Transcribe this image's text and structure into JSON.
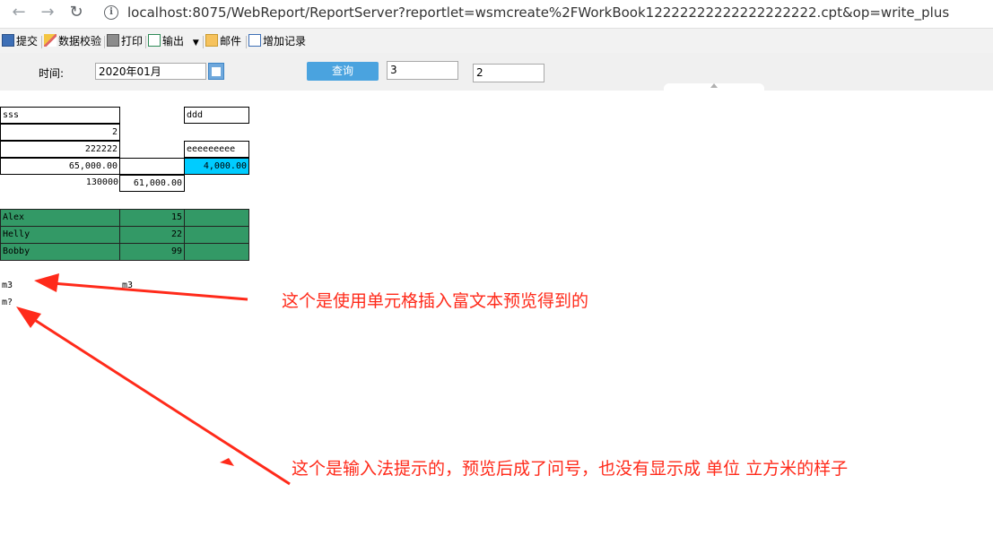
{
  "browser": {
    "url": "localhost:8075/WebReport/ReportServer?reportlet=wsmcreate%2FWorkBook12222222222222222222.cpt&op=write_plus",
    "back_icon": "arrow-left-icon",
    "forward_icon": "arrow-right-icon",
    "reload_icon": "reload-icon",
    "info_icon": "info-icon"
  },
  "toolbar": {
    "submit": "提交",
    "validate": "数据校验",
    "print": "打印",
    "export": "输出",
    "mail": "邮件",
    "add_record": "增加记录"
  },
  "params": {
    "time_label": "时间:",
    "date_value": "2020年01月",
    "query_label": "查询",
    "input1_value": "3",
    "input2_value": "2"
  },
  "report": {
    "sss": "sss",
    "ddd": "ddd",
    "val_2": "2",
    "val_222222": "222222",
    "val_eee": "eeeeeeeee",
    "val_65000": "65,000.00",
    "val_4000": "4,000.00",
    "val_130000": "130000",
    "val_61000": "61,000.00",
    "people": [
      {
        "name": "Alex",
        "value": "15"
      },
      {
        "name": "Helly",
        "value": "22"
      },
      {
        "name": "Bobby",
        "value": "99"
      }
    ],
    "m3_a": "m3",
    "m3_b": "m3",
    "m_q": "m?"
  },
  "annotations": {
    "note1": "这个是使用单元格插入富文本预览得到的",
    "note2": "这个是输入法提示的，预览后成了问号，也没有显示成 单位 立方米的样子"
  },
  "colors": {
    "green_row": "#339966",
    "highlight": "#00ccff",
    "annotation": "#ff2a1a",
    "query_button": "#4aa3df"
  }
}
